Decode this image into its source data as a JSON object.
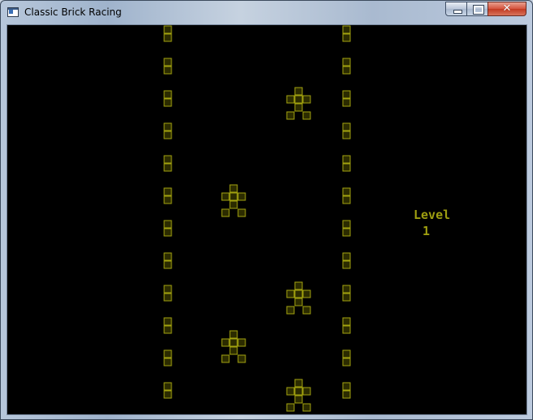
{
  "window": {
    "title": "Classic Brick Racing",
    "close_glyph": "✕"
  },
  "game": {
    "level_label": "Level",
    "level_value": "1",
    "brick_color": "#a3a30f",
    "brick_fill": "#2c2c00",
    "background": "#000000",
    "board": {
      "cols": 20,
      "rows": 24,
      "walls": [
        {
          "col": 10,
          "rows": [
            0,
            2,
            4,
            6,
            8,
            10,
            12,
            14,
            16,
            18,
            20,
            22,
            24
          ]
        },
        {
          "col": 21,
          "rows": [
            0,
            2,
            4,
            6,
            8,
            10,
            12,
            14,
            16,
            18,
            20,
            22,
            24
          ]
        }
      ],
      "cars": [
        {
          "kind": "opponent",
          "lane": "right",
          "top_row": 4
        },
        {
          "kind": "opponent",
          "lane": "left",
          "top_row": 10
        },
        {
          "kind": "opponent",
          "lane": "right",
          "top_row": 16
        },
        {
          "kind": "opponent",
          "lane": "left",
          "top_row": 19
        },
        {
          "kind": "player",
          "lane": "right",
          "top_row": 22
        }
      ]
    }
  }
}
